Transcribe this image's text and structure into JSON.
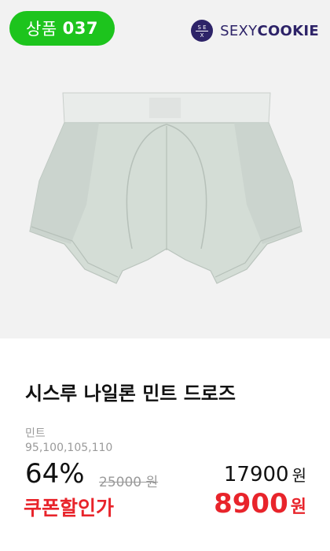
{
  "product": {
    "badge_prefix": "상품",
    "badge_number": "037",
    "brand_light": "SEXY",
    "brand_bold": "COOKIE",
    "title": "시스루 나일론 민트 드로즈",
    "color": "민트",
    "sizes": "95,100,105,110",
    "discount": "64%",
    "original_price": "25000 원",
    "price": "17900",
    "price_unit": "원",
    "coupon_label": "쿠폰할인가",
    "coupon_price": "8900",
    "coupon_unit": "원"
  },
  "colors": {
    "badge_bg": "#1dc41d",
    "brand": "#2d2368",
    "coupon": "#e8242b",
    "product_mint": "#d4ddd6"
  }
}
